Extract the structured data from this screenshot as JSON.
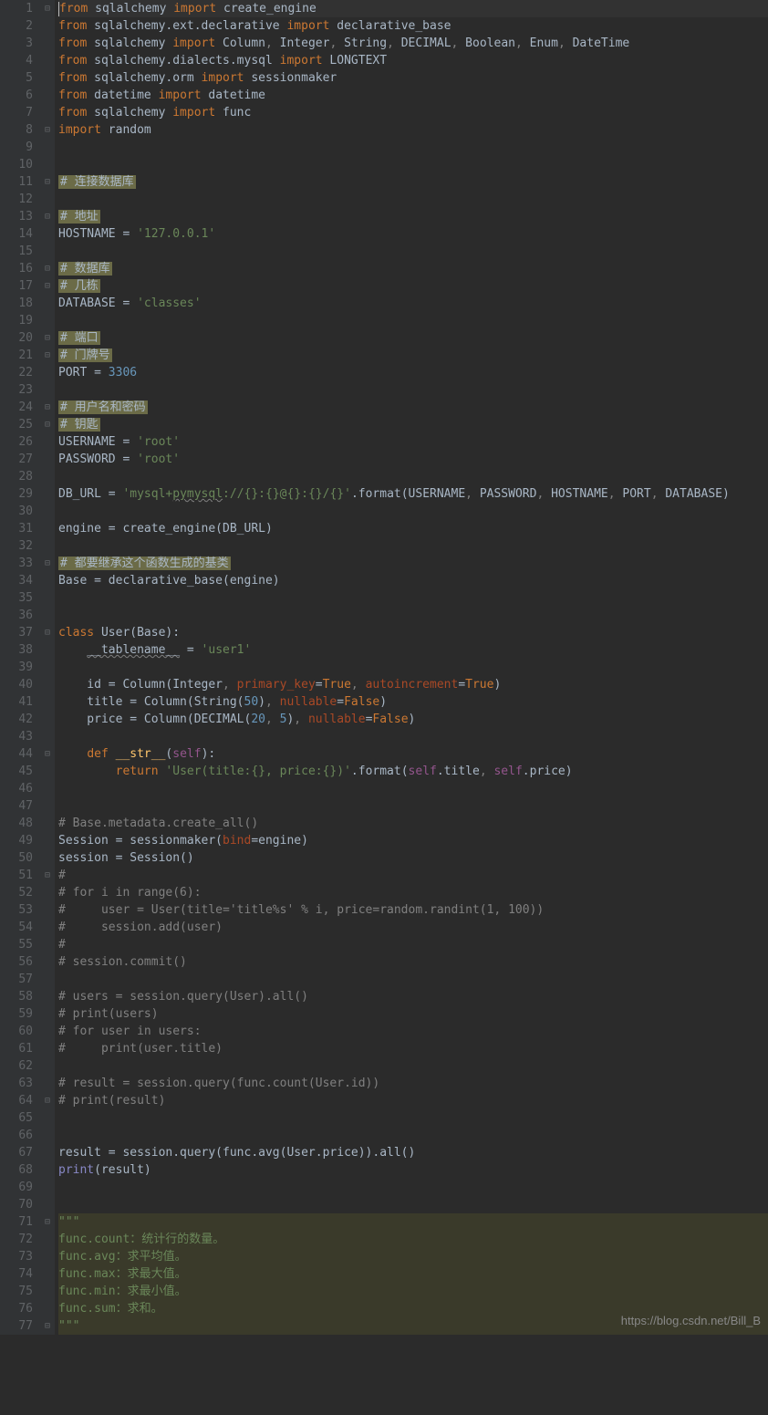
{
  "watermark": "https://blog.csdn.net/Bill_B",
  "lines": [
    {
      "n": 1,
      "fold": "⊟",
      "tokens": [
        [
          "kw",
          "from"
        ],
        [
          "ident",
          " sqlalchemy "
        ],
        [
          "kw",
          "import"
        ],
        [
          "ident",
          " create_engine"
        ]
      ],
      "hl": true
    },
    {
      "n": 2,
      "tokens": [
        [
          "kw",
          "from"
        ],
        [
          "ident",
          " sqlalchemy.ext.declarative "
        ],
        [
          "kw",
          "import"
        ],
        [
          "ident",
          " declarative_base"
        ]
      ]
    },
    {
      "n": 3,
      "tokens": [
        [
          "kw",
          "from"
        ],
        [
          "ident",
          " sqlalchemy "
        ],
        [
          "kw",
          "import"
        ],
        [
          "ident",
          " Column"
        ],
        [
          "cmt",
          ","
        ],
        [
          "ident",
          " Integer"
        ],
        [
          "cmt",
          ","
        ],
        [
          "ident",
          " String"
        ],
        [
          "cmt",
          ","
        ],
        [
          "ident",
          " DECIMAL"
        ],
        [
          "cmt",
          ","
        ],
        [
          "ident",
          " Boolean"
        ],
        [
          "cmt",
          ","
        ],
        [
          "ident",
          " Enum"
        ],
        [
          "cmt",
          ","
        ],
        [
          "ident",
          " DateTime"
        ]
      ]
    },
    {
      "n": 4,
      "tokens": [
        [
          "kw",
          "from"
        ],
        [
          "ident",
          " sqlalchemy.dialects.mysql "
        ],
        [
          "kw",
          "import"
        ],
        [
          "ident",
          " LONGTEXT"
        ]
      ]
    },
    {
      "n": 5,
      "tokens": [
        [
          "kw",
          "from"
        ],
        [
          "ident",
          " sqlalchemy.orm "
        ],
        [
          "kw",
          "import"
        ],
        [
          "ident",
          " sessionmaker"
        ]
      ]
    },
    {
      "n": 6,
      "tokens": [
        [
          "kw",
          "from"
        ],
        [
          "ident",
          " datetime "
        ],
        [
          "kw",
          "import"
        ],
        [
          "ident",
          " datetime"
        ]
      ]
    },
    {
      "n": 7,
      "tokens": [
        [
          "kw",
          "from"
        ],
        [
          "ident",
          " sqlalchemy "
        ],
        [
          "kw",
          "import"
        ],
        [
          "ident",
          " func"
        ]
      ]
    },
    {
      "n": 8,
      "fold": "⊟",
      "tokens": [
        [
          "kw",
          "import"
        ],
        [
          "ident",
          " random"
        ]
      ]
    },
    {
      "n": 9,
      "tokens": []
    },
    {
      "n": 10,
      "tokens": []
    },
    {
      "n": 11,
      "fold": "⊟",
      "tokens": [
        [
          "cmt-hl",
          "# 连接数据库"
        ]
      ]
    },
    {
      "n": 12,
      "tokens": []
    },
    {
      "n": 13,
      "fold": "⊟",
      "tokens": [
        [
          "cmt-hl",
          "# 地址"
        ]
      ]
    },
    {
      "n": 14,
      "tokens": [
        [
          "ident",
          "HOSTNAME = "
        ],
        [
          "str",
          "'127.0.0.1'"
        ]
      ]
    },
    {
      "n": 15,
      "tokens": []
    },
    {
      "n": 16,
      "fold": "⊟",
      "tokens": [
        [
          "cmt-hl",
          "# 数据库"
        ]
      ]
    },
    {
      "n": 17,
      "fold": "⊟",
      "tokens": [
        [
          "cmt-hl",
          "# 几栋"
        ]
      ]
    },
    {
      "n": 18,
      "tokens": [
        [
          "ident",
          "DATABASE = "
        ],
        [
          "str",
          "'classes'"
        ]
      ]
    },
    {
      "n": 19,
      "tokens": []
    },
    {
      "n": 20,
      "fold": "⊟",
      "tokens": [
        [
          "cmt-hl",
          "# 端口"
        ]
      ]
    },
    {
      "n": 21,
      "fold": "⊟",
      "tokens": [
        [
          "cmt-hl",
          "# 门牌号"
        ]
      ]
    },
    {
      "n": 22,
      "tokens": [
        [
          "ident",
          "PORT = "
        ],
        [
          "num",
          "3306"
        ]
      ]
    },
    {
      "n": 23,
      "tokens": []
    },
    {
      "n": 24,
      "fold": "⊟",
      "tokens": [
        [
          "cmt-hl",
          "# 用户名和密码"
        ]
      ]
    },
    {
      "n": 25,
      "fold": "⊟",
      "tokens": [
        [
          "cmt-hl",
          "# 钥匙"
        ]
      ]
    },
    {
      "n": 26,
      "tokens": [
        [
          "ident",
          "USERNAME = "
        ],
        [
          "str",
          "'root'"
        ]
      ]
    },
    {
      "n": 27,
      "tokens": [
        [
          "ident",
          "PASSWORD = "
        ],
        [
          "str",
          "'root'"
        ]
      ]
    },
    {
      "n": 28,
      "tokens": []
    },
    {
      "n": 29,
      "tokens": [
        [
          "ident",
          "DB_URL = "
        ],
        [
          "str",
          "'mysql+"
        ],
        [
          "str-u",
          "pymysql"
        ],
        [
          "str",
          "://{}:{}@{}:{}/{}'"
        ],
        [
          "ident",
          ".format(USERNAME"
        ],
        [
          "cmt",
          ","
        ],
        [
          "ident",
          " PASSWORD"
        ],
        [
          "cmt",
          ","
        ],
        [
          "ident",
          " HOSTNAME"
        ],
        [
          "cmt",
          ","
        ],
        [
          "ident",
          " PORT"
        ],
        [
          "cmt",
          ","
        ],
        [
          "ident",
          " DATABASE)"
        ]
      ]
    },
    {
      "n": 30,
      "tokens": []
    },
    {
      "n": 31,
      "tokens": [
        [
          "ident",
          "engine = create_engine(DB_URL)"
        ]
      ]
    },
    {
      "n": 32,
      "tokens": []
    },
    {
      "n": 33,
      "fold": "⊟",
      "tokens": [
        [
          "cmt-hl",
          "# 都要继承这个函数生成的基类"
        ]
      ]
    },
    {
      "n": 34,
      "tokens": [
        [
          "ident",
          "Base = declarative_base(engine)"
        ]
      ]
    },
    {
      "n": 35,
      "tokens": []
    },
    {
      "n": 36,
      "tokens": []
    },
    {
      "n": 37,
      "fold": "⊟",
      "tokens": [
        [
          "kw",
          "class "
        ],
        [
          "ident",
          "User(Base):"
        ]
      ],
      "break": true
    },
    {
      "n": 38,
      "tokens": [
        [
          "ident",
          "    "
        ],
        [
          "ident-u",
          "__tablename__"
        ],
        [
          "ident",
          " = "
        ],
        [
          "str",
          "'user1'"
        ]
      ]
    },
    {
      "n": 39,
      "tokens": []
    },
    {
      "n": 40,
      "tokens": [
        [
          "ident",
          "    id = Column(Integer"
        ],
        [
          "cmt",
          ", "
        ],
        [
          "param",
          "primary_key"
        ],
        [
          "ident",
          "="
        ],
        [
          "kw",
          "True"
        ],
        [
          "cmt",
          ", "
        ],
        [
          "param",
          "autoincrement"
        ],
        [
          "ident",
          "="
        ],
        [
          "kw",
          "True"
        ],
        [
          "ident",
          ")"
        ]
      ]
    },
    {
      "n": 41,
      "tokens": [
        [
          "ident",
          "    title = Column(String("
        ],
        [
          "num",
          "50"
        ],
        [
          "ident",
          ")"
        ],
        [
          "cmt",
          ", "
        ],
        [
          "param",
          "nullable"
        ],
        [
          "ident",
          "="
        ],
        [
          "kw",
          "False"
        ],
        [
          "ident",
          ")"
        ]
      ]
    },
    {
      "n": 42,
      "tokens": [
        [
          "ident",
          "    price = Column(DECIMAL("
        ],
        [
          "num",
          "20"
        ],
        [
          "cmt",
          ", "
        ],
        [
          "num",
          "5"
        ],
        [
          "ident",
          ")"
        ],
        [
          "cmt",
          ", "
        ],
        [
          "param",
          "nullable"
        ],
        [
          "ident",
          "="
        ],
        [
          "kw",
          "False"
        ],
        [
          "ident",
          ")"
        ]
      ]
    },
    {
      "n": 43,
      "tokens": []
    },
    {
      "n": 44,
      "fold": "⊟",
      "tokens": [
        [
          "ident",
          "    "
        ],
        [
          "kw",
          "def "
        ],
        [
          "fn",
          "__str__"
        ],
        [
          "ident",
          "("
        ],
        [
          "self",
          "self"
        ],
        [
          "ident",
          "):"
        ]
      ]
    },
    {
      "n": 45,
      "tokens": [
        [
          "ident",
          "        "
        ],
        [
          "kw",
          "return "
        ],
        [
          "str",
          "'User(title:{}, price:{})'"
        ],
        [
          "ident",
          ".format("
        ],
        [
          "self",
          "self"
        ],
        [
          "ident",
          ".title"
        ],
        [
          "cmt",
          ", "
        ],
        [
          "self",
          "self"
        ],
        [
          "ident",
          ".price)"
        ]
      ]
    },
    {
      "n": 46,
      "tokens": []
    },
    {
      "n": 47,
      "tokens": []
    },
    {
      "n": 48,
      "tokens": [
        [
          "cmt",
          "# Base.metadata.create_all()"
        ]
      ]
    },
    {
      "n": 49,
      "tokens": [
        [
          "ident",
          "Session = sessionmaker("
        ],
        [
          "param",
          "bind"
        ],
        [
          "ident",
          "=engine)"
        ]
      ]
    },
    {
      "n": 50,
      "tokens": [
        [
          "ident",
          "session = Session()"
        ]
      ]
    },
    {
      "n": 51,
      "fold": "⊟",
      "tokens": [
        [
          "cmt",
          "#"
        ]
      ]
    },
    {
      "n": 52,
      "tokens": [
        [
          "cmt",
          "# for i in range(6):"
        ]
      ]
    },
    {
      "n": 53,
      "tokens": [
        [
          "cmt",
          "#     user = User(title='title%s' % i, price=random.randint(1, 100))"
        ]
      ]
    },
    {
      "n": 54,
      "tokens": [
        [
          "cmt",
          "#     session.add(user)"
        ]
      ]
    },
    {
      "n": 55,
      "tokens": [
        [
          "cmt",
          "#"
        ]
      ]
    },
    {
      "n": 56,
      "tokens": [
        [
          "cmt",
          "# session.commit()"
        ]
      ]
    },
    {
      "n": 57,
      "tokens": []
    },
    {
      "n": 58,
      "tokens": [
        [
          "cmt",
          "# users = session.query(User).all()"
        ]
      ]
    },
    {
      "n": 59,
      "tokens": [
        [
          "cmt",
          "# print(users)"
        ]
      ]
    },
    {
      "n": 60,
      "tokens": [
        [
          "cmt",
          "# for user in users:"
        ]
      ]
    },
    {
      "n": 61,
      "tokens": [
        [
          "cmt",
          "#     print(user.title)"
        ]
      ]
    },
    {
      "n": 62,
      "tokens": []
    },
    {
      "n": 63,
      "tokens": [
        [
          "cmt",
          "# result = session.query(func.count(User.id))"
        ]
      ]
    },
    {
      "n": 64,
      "fold": "⊟",
      "tokens": [
        [
          "cmt",
          "# print(result)"
        ]
      ]
    },
    {
      "n": 65,
      "tokens": []
    },
    {
      "n": 66,
      "tokens": []
    },
    {
      "n": 67,
      "tokens": [
        [
          "ident",
          "result = session.query(func.avg(User.price)).all()"
        ]
      ]
    },
    {
      "n": 68,
      "tokens": [
        [
          "builtin",
          "print"
        ],
        [
          "ident",
          "(result)"
        ]
      ]
    },
    {
      "n": 69,
      "tokens": []
    },
    {
      "n": 70,
      "tokens": []
    },
    {
      "n": 71,
      "fold": "⊟",
      "tokens": [
        [
          "docstr",
          "\"\"\""
        ]
      ],
      "doc": true
    },
    {
      "n": 72,
      "tokens": [
        [
          "docstr",
          "func.count：统计行的数量。"
        ]
      ],
      "doc": true
    },
    {
      "n": 73,
      "tokens": [
        [
          "docstr",
          "func.avg：求平均值。"
        ]
      ],
      "doc": true
    },
    {
      "n": 74,
      "tokens": [
        [
          "docstr",
          "func.max：求最大值。"
        ]
      ],
      "doc": true
    },
    {
      "n": 75,
      "tokens": [
        [
          "docstr",
          "func.min：求最小值。"
        ]
      ],
      "doc": true
    },
    {
      "n": 76,
      "tokens": [
        [
          "docstr",
          "func.sum：求和。"
        ]
      ],
      "doc": true
    },
    {
      "n": 77,
      "fold": "⊟",
      "tokens": [
        [
          "docstr",
          "\"\"\""
        ]
      ],
      "doc": true
    }
  ]
}
